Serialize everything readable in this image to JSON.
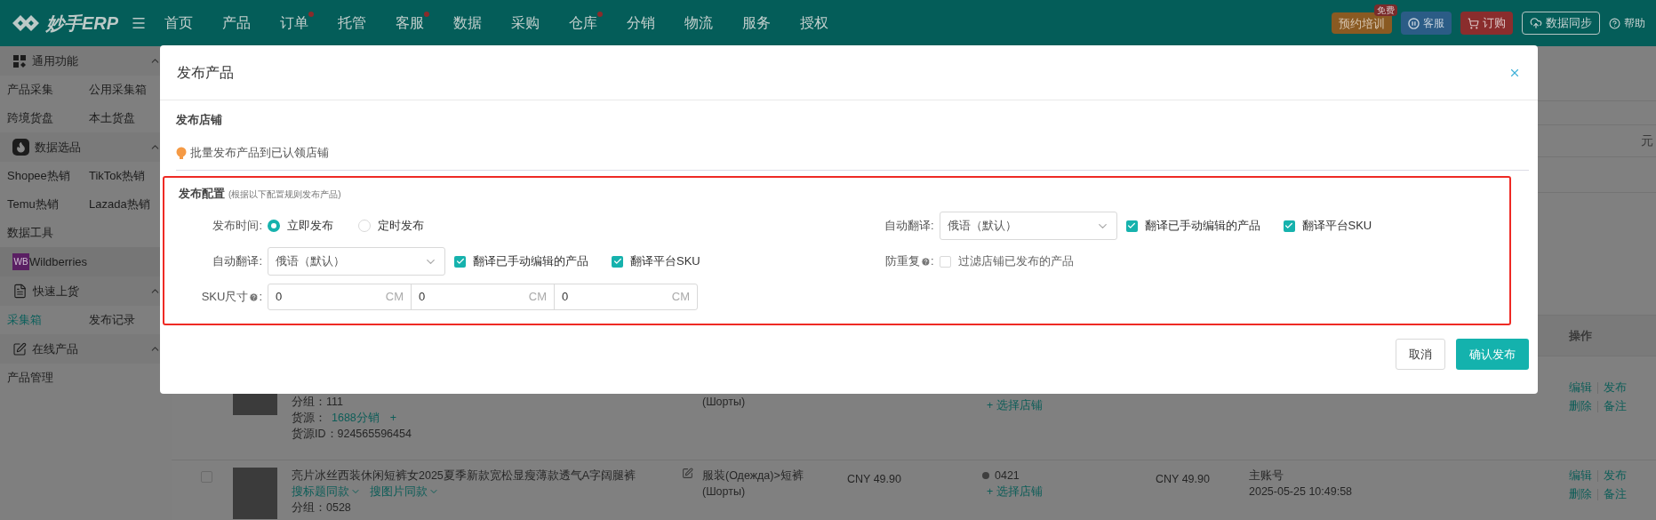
{
  "top_bar": {
    "logo": "妙手ERP",
    "nav": [
      {
        "label": "首页",
        "dot": false
      },
      {
        "label": "产品",
        "dot": false
      },
      {
        "label": "订单",
        "dot": true
      },
      {
        "label": "托管",
        "dot": false
      },
      {
        "label": "客服",
        "dot": true
      },
      {
        "label": "数据",
        "dot": false
      },
      {
        "label": "采购",
        "dot": false
      },
      {
        "label": "仓库",
        "dot": true
      },
      {
        "label": "分销",
        "dot": false
      },
      {
        "label": "物流",
        "dot": false
      },
      {
        "label": "服务",
        "dot": false
      },
      {
        "label": "授权",
        "dot": false
      }
    ],
    "actions": [
      {
        "kind": "training",
        "label": "预约培训",
        "badge": "免费"
      },
      {
        "kind": "service",
        "label": "客服"
      },
      {
        "kind": "order",
        "label": "订购"
      },
      {
        "kind": "sync",
        "label": "数据同步"
      },
      {
        "kind": "help",
        "label": "帮助"
      }
    ]
  },
  "sidebar": {
    "groups": [
      {
        "kind": "grid",
        "title": "通用功能",
        "expanded": true,
        "items": [
          {
            "label": "产品采集",
            "selected": false
          },
          {
            "label": "公用采集箱",
            "selected": false
          },
          {
            "label": "跨境货盘",
            "selected": false
          },
          {
            "label": "本土货盘",
            "selected": false
          }
        ]
      },
      {
        "kind": "fire",
        "title": "数据选品",
        "expanded": true,
        "items": [
          {
            "label": "Shopee热销",
            "selected": false
          },
          {
            "label": "TikTok热销",
            "selected": false
          },
          {
            "label": "Temu热销",
            "selected": false
          },
          {
            "label": "Lazada热销",
            "selected": false
          },
          {
            "label": "数据工具",
            "selected": false
          }
        ]
      },
      {
        "kind": "wb",
        "badge": "WB",
        "title": "Wildberries"
      },
      {
        "kind": "doc",
        "title": "快速上货",
        "expanded": true,
        "items": [
          {
            "label": "采集箱",
            "selected": true
          },
          {
            "label": "发布记录",
            "selected": false
          }
        ]
      },
      {
        "kind": "edit",
        "title": "在线产品",
        "expanded": true,
        "items": [
          {
            "label": "产品管理",
            "selected": false
          }
        ]
      }
    ]
  },
  "background": {
    "header_cell": "元",
    "action_column": "操作",
    "rows": [
      {
        "group": "分组：111",
        "source_label": "货源：",
        "source_link": "1688分销",
        "source_add": "+",
        "source_id": "货源ID：924565596454",
        "category": [
          "(Шорты)"
        ],
        "store_add": "+ 选择店铺",
        "actions": [
          "编辑",
          "发布",
          "删除",
          "备注"
        ]
      },
      {
        "checked": false,
        "title": "亮片冰丝西装休闲短裤女2025夏季新款宽松显瘦薄款透气A字阔腿裤",
        "search_links": [
          "搜标题同款",
          "搜图片同款"
        ],
        "group": "分组：0528",
        "category": [
          "服装(Одежда)>短裤",
          "(Шорты)"
        ],
        "price": "CNY 49.90",
        "store": "0421",
        "store_add": "+ 选择店铺",
        "price2": "CNY 49.90",
        "account": "主账号",
        "date": "2025-05-25 10:49:58",
        "actions": [
          "编辑",
          "发布",
          "删除",
          "备注"
        ]
      }
    ]
  },
  "dialog": {
    "title": "发布产品",
    "store_section": {
      "title": "发布店铺",
      "tip": "批量发布产品到已认领店铺"
    },
    "config": {
      "title": "发布配置",
      "note": "(根据以下配置规则发布产品)",
      "rows": [
        {
          "left": {
            "kind": "radio",
            "label": "发布时间:",
            "options": [
              {
                "label": "立即发布",
                "selected": true
              },
              {
                "label": "定时发布",
                "selected": false
              }
            ]
          },
          "right": {
            "kind": "select",
            "label": "自动翻译:",
            "value": "俄语（默认）",
            "checkboxes": [
              {
                "label": "翻译已手动编辑的产品",
                "checked": true
              },
              {
                "label": "翻译平台SKU",
                "checked": true
              }
            ]
          }
        },
        {
          "left": {
            "kind": "select",
            "label": "自动翻译:",
            "value": "俄语（默认）",
            "checkboxes": [
              {
                "label": "翻译已手动编辑的产品",
                "checked": true
              },
              {
                "label": "翻译平台SKU",
                "checked": true
              }
            ]
          },
          "right": {
            "kind": "checks",
            "label": "防重复",
            "help": true,
            "label_end": ":",
            "checkboxes": [
              {
                "label": "过滤店铺已发布的产品",
                "checked": false
              }
            ]
          }
        },
        {
          "left": {
            "kind": "dimensions",
            "label": "SKU尺寸",
            "help": true,
            "label_end": ":",
            "inputs": [
              {
                "value": "0",
                "unit": "CM"
              },
              {
                "value": "0",
                "unit": "CM"
              },
              {
                "value": "0",
                "unit": "CM"
              }
            ]
          }
        }
      ]
    },
    "buttons": [
      {
        "kind": "secondary",
        "label": "取消"
      },
      {
        "kind": "primary",
        "label": "确认发布"
      }
    ]
  }
}
